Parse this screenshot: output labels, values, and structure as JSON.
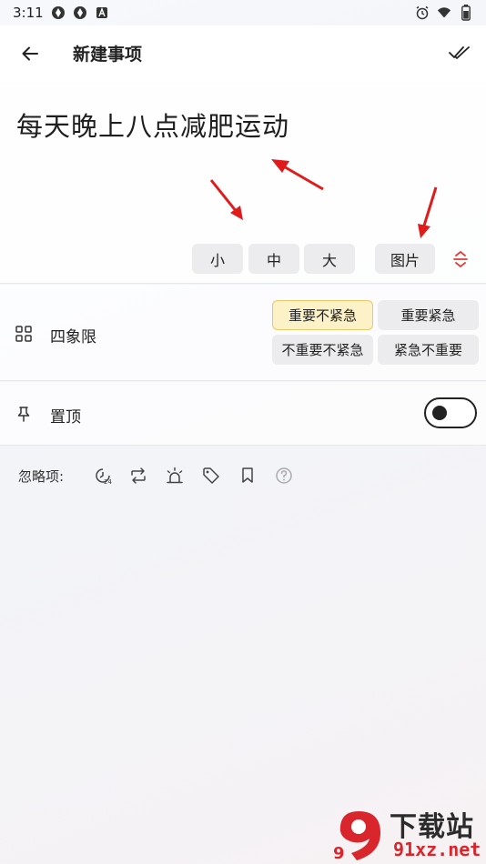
{
  "status_bar": {
    "time": "3:11",
    "left_icons": [
      "app-icon-1",
      "app-icon-2",
      "font-app-icon"
    ],
    "right_icons": [
      "alarm-icon",
      "wifi-icon",
      "battery-icon"
    ]
  },
  "header": {
    "title": "新建事项",
    "back_icon": "arrow-left-icon",
    "done_icon": "double-check-icon"
  },
  "editor": {
    "text": "每天晚上八点减肥运动",
    "size_buttons": [
      "小",
      "中",
      "大"
    ],
    "image_button": "图片",
    "collapse_icon": "collapse-icon",
    "accent_color": "#e53935"
  },
  "quadrant": {
    "label": "四象限",
    "icon": "grid-icon",
    "options": [
      "重要不紧急",
      "重要紧急",
      "不重要不紧急",
      "紧急不重要"
    ],
    "selected": "重要不紧急"
  },
  "pin": {
    "label": "置顶",
    "icon": "pin-icon",
    "enabled": false
  },
  "ignore": {
    "label": "忽略项:",
    "icons": [
      "time-24-icon",
      "repeat-icon",
      "alarm-light-icon",
      "tag-icon",
      "bookmark-icon",
      "help-icon"
    ]
  },
  "annotations": {
    "arrow_color": "#e01b1b"
  },
  "watermark": {
    "title": "下载站",
    "url": "91xz.net",
    "logo_text": "9",
    "brand_color": "#d8262c"
  }
}
